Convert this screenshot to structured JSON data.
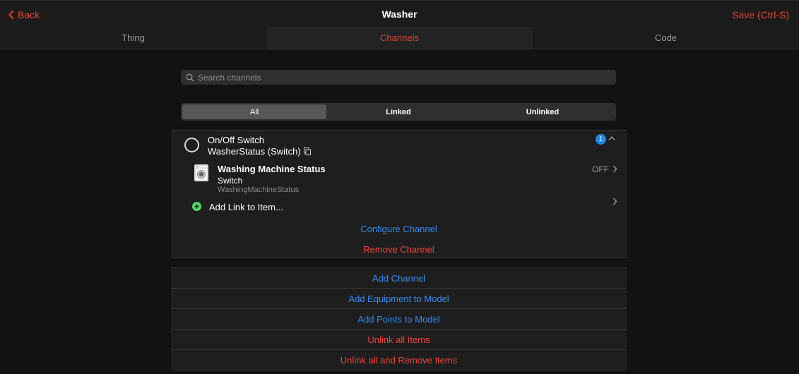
{
  "nav": {
    "back_label": "Back",
    "title": "Washer",
    "save_label": "Save (Ctrl-S)"
  },
  "tabs": [
    {
      "label": "Thing",
      "active": false
    },
    {
      "label": "Channels",
      "active": true
    },
    {
      "label": "Code",
      "active": false
    }
  ],
  "search": {
    "placeholder": "Search channels",
    "value": ""
  },
  "filter": {
    "options": [
      "All",
      "Linked",
      "Unlinked"
    ],
    "selected": "All"
  },
  "channel": {
    "title": "On/Off Switch",
    "subtitle": "WasherStatus (Switch)",
    "link_count": "1",
    "linked_item": {
      "title": "Washing Machine Status",
      "type": "Switch",
      "name": "WashingMachineStatus",
      "state": "OFF"
    },
    "add_link_label": "Add Link to Item...",
    "configure_label": "Configure Channel",
    "remove_label": "Remove Channel"
  },
  "actions": [
    {
      "label": "Add Channel",
      "color": "blue"
    },
    {
      "label": "Add Equipment to Model",
      "color": "blue"
    },
    {
      "label": "Add Points to Model",
      "color": "blue"
    },
    {
      "label": "Unlink all Items",
      "color": "red"
    },
    {
      "label": "Unlink all and Remove Items",
      "color": "red"
    }
  ],
  "colors": {
    "accent": "#e9432b",
    "link_blue": "#2f8cf0",
    "danger_red": "#f0433a",
    "badge_blue": "#1e88e5",
    "add_green": "#4cd964"
  }
}
